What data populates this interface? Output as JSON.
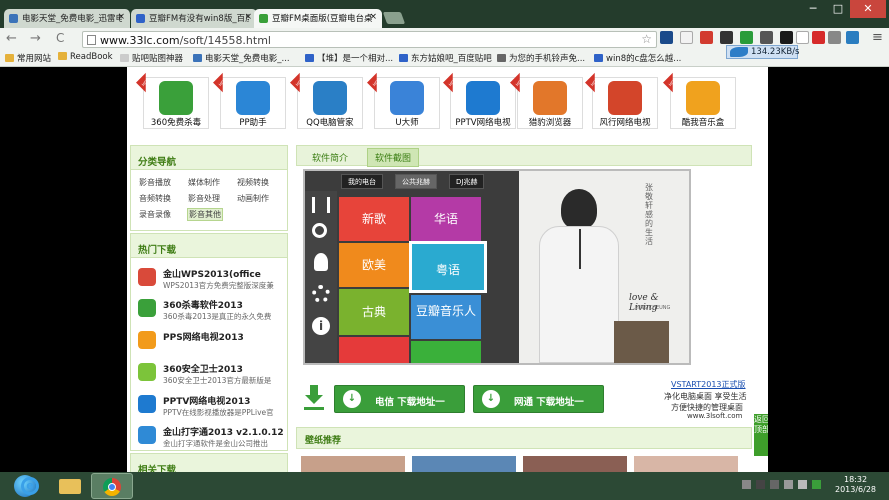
{
  "browser": {
    "tabs": [
      {
        "label": "电影天堂_免费电影_迅雷电",
        "active": false,
        "favicon_color": "#3b73b9"
      },
      {
        "label": "豆瓣FM有没有win8版_百度",
        "active": false,
        "favicon_color": "#2f62c8"
      },
      {
        "label": "豆瓣FM桌面版(豆瓣电台桌",
        "active": true,
        "favicon_color": "#3aa03a"
      }
    ],
    "tab_close": "×",
    "window_buttons": {
      "minimize": "─",
      "maximize": "□",
      "close": "✕"
    },
    "back": "←",
    "forward": "→",
    "reload": "C",
    "url_host": "www.33lc.com",
    "url_path": "/soft/14558.html",
    "star": "☆",
    "extension_colors": [
      "#1a4a8a",
      "#f2f2f2",
      "#d23b2f",
      "#333333",
      "#2a9c3a",
      "#555555",
      "#1a1a1a",
      "#ffffff",
      "#d62a2a",
      "#888888",
      "#2a7dc0",
      "#6a6a6a",
      "#4fc03b",
      "#2ca02c",
      "#444444"
    ],
    "speed": "134.23KB/s",
    "menu_icon": "≡",
    "bookmarks": [
      {
        "label": "常用网站",
        "icon": "folder",
        "color": "#e5b13a"
      },
      {
        "label": "ReadBook",
        "icon": "folder",
        "color": "#e5b13a"
      },
      {
        "label": "贴吧贴图神器",
        "icon": "page",
        "color": "#cccccc"
      },
      {
        "label": "电影天堂_免费电影_...",
        "icon": "page",
        "color": "#3b73b9"
      },
      {
        "label": "【堆】是一个相对...",
        "icon": "page",
        "color": "#2f62c8"
      },
      {
        "label": "东方姑娘吧_百度贴吧",
        "icon": "page",
        "color": "#2f62c8"
      },
      {
        "label": "为您的手机铃声免...",
        "icon": "page",
        "color": "#666666"
      },
      {
        "label": "win8的c盘怎么越...",
        "icon": "page",
        "color": "#2f62c8"
      }
    ]
  },
  "site": {
    "software": [
      {
        "label": "360免费杀毒",
        "color": "#3aa03a"
      },
      {
        "label": "PP助手",
        "color": "#2b86d6"
      },
      {
        "label": "QQ电脑管家",
        "color": "#2a7fc6"
      },
      {
        "label": "U大师",
        "color": "#3a83d8"
      },
      {
        "label": "PPTV网络电视",
        "color": "#1e7ad0"
      },
      {
        "label": "猎豹浏览器",
        "color": "#e2772a"
      },
      {
        "label": "风行网络电视",
        "color": "#d3452a"
      },
      {
        "label": "酷我音乐盒",
        "color": "#f0a21e"
      }
    ],
    "hot_badge": "HOT",
    "category_title": "分类导航",
    "categories": [
      "影音播放",
      "媒体制作",
      "视频转换",
      "音频转换",
      "影音处理",
      "动画制作",
      "录音录像",
      "影音其他"
    ],
    "selected_category": "影音其他",
    "hot_title": "热门下载",
    "hot_downloads": [
      {
        "title": "金山WPS2013(office",
        "desc": "WPS2013官方免费完整版深度兼",
        "color": "#d94a3a"
      },
      {
        "title": "360杀毒软件2013",
        "desc": "360杀毒2013是真正的永久免费",
        "color": "#3aa03a"
      },
      {
        "title": "PPS网络电视2013",
        "desc": "",
        "color": "#f29b1b"
      },
      {
        "title": "360安全卫士2013",
        "desc": "360安全卫士2013官方最新版是",
        "color": "#7cc43a"
      },
      {
        "title": "PPTV网络电视2013",
        "desc": "PPTV在线影视播放器是PPLive官",
        "color": "#1e7ad0"
      },
      {
        "title": "金山打字通2013 v2.1.0.12",
        "desc": "金山打字通软件是金山公司推出",
        "color": "#2f8ad6"
      }
    ],
    "related_title": "相关下载",
    "content_tabs": [
      "软件简介",
      "软件截图"
    ],
    "active_tab": "软件截图",
    "screenshot": {
      "top_buttons": [
        "我的电台",
        "公共兆赫",
        "DJ兆赫"
      ],
      "tiles": [
        {
          "label": "新歌",
          "color": "#e7443a"
        },
        {
          "label": "华语",
          "color": "#b43aa6"
        },
        {
          "label": "欧美",
          "color": "#f08a1c"
        },
        {
          "label": "粤语",
          "color": "#2aaad0"
        },
        {
          "label": "古典",
          "color": "#7ab22e"
        },
        {
          "label": "豆瓣音乐人",
          "color": "#3a8fd6"
        },
        {
          "label": "",
          "color": "#e53a3a"
        },
        {
          "label": "",
          "color": "#3ab03a"
        }
      ],
      "photo_caption": "love & Living",
      "photo_sub": "HINS CHEUNG",
      "photo_vertical": "张敬轩 感的 生活"
    },
    "download": {
      "dianxin": "电信 下载地址一",
      "wangtong": "网通 下载地址一",
      "ad_title": "VSTART2013正式版",
      "ad_line1": "净化电脑桌面 享受生活",
      "ad_line2": "方便快捷的管理桌面",
      "ad_url": "www.3lsoft.com"
    },
    "wallpaper_title": "壁纸推荐",
    "back_to_top": "返回顶部"
  },
  "taskbar": {
    "time": "18:32",
    "date": "2013/6/28"
  }
}
